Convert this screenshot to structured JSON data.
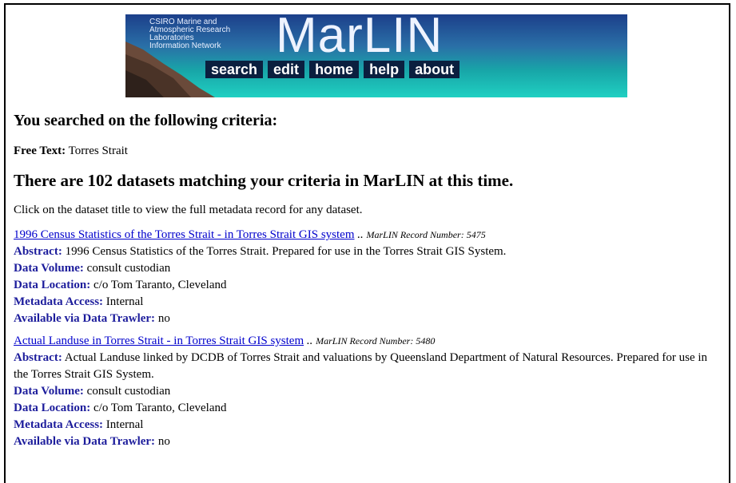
{
  "banner": {
    "org_name": "CSIRO Marine and\nAtmospheric Research\nLaboratories\nInformation Network",
    "logo": "MarLIN",
    "nav": [
      {
        "label": "search"
      },
      {
        "label": "edit"
      },
      {
        "label": "home"
      },
      {
        "label": "help"
      },
      {
        "label": "about"
      }
    ],
    "colors": {
      "nav_bg": "#0b1f3f",
      "banner_top": "#1c3f8a",
      "banner_bottom": "#20d0c2"
    }
  },
  "search": {
    "heading": "You searched on the following criteria:",
    "free_text_label": "Free Text:",
    "free_text_value": "Torres Strait"
  },
  "results": {
    "heading": "There are 102 datasets matching your criteria in MarLIN at this time.",
    "instructions": "Click on the dataset title to view the full metadata record for any dataset.",
    "labels": {
      "abstract": "Abstract:",
      "volume": "Data Volume:",
      "location": "Data Location:",
      "access": "Metadata Access:",
      "trawler": "Available via Data Trawler:"
    },
    "separator": "..",
    "records": [
      {
        "title": "1996 Census Statistics of the Torres Strait - in Torres Strait GIS system",
        "record_number": "MarLIN Record Number: 5475",
        "abstract": "1996 Census Statistics of the Torres Strait. Prepared for use in the Torres Strait GIS System.",
        "volume": "consult custodian",
        "location": "c/o Tom Taranto, Cleveland",
        "access": "Internal",
        "trawler": "no"
      },
      {
        "title": "Actual Landuse in Torres Strait - in Torres Strait GIS system",
        "record_number": "MarLIN Record Number: 5480",
        "abstract": "Actual Landuse linked by DCDB of Torres Strait and valuations by Queensland Department of Natural Resources. Prepared for use in the Torres Strait GIS System.",
        "volume": "consult custodian",
        "location": "c/o Tom Taranto, Cleveland",
        "access": "Internal",
        "trawler": "no"
      }
    ]
  }
}
